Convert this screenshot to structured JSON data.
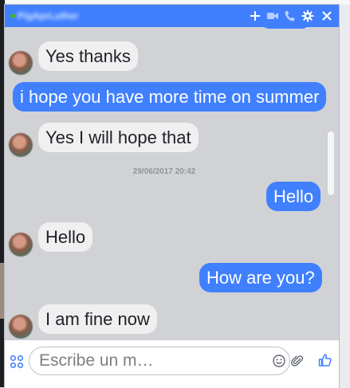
{
  "chat": {
    "contact_name": "PigAprLuther",
    "colors": {
      "accent": "#4080ff",
      "incoming": "#f1f0f0",
      "window_bg": "#d1d2d5"
    },
    "header_icons": [
      "plus-icon",
      "video-icon",
      "phone-icon",
      "gear-icon",
      "close-icon"
    ],
    "messages": [
      {
        "from": "them",
        "text": "Yes thanks"
      },
      {
        "from": "me",
        "text": "i hope you have more time on summer"
      },
      {
        "from": "them",
        "text": "Yes I will hope that"
      },
      {
        "from": "me",
        "text": "Hello"
      },
      {
        "from": "them",
        "text": "Hello"
      },
      {
        "from": "me",
        "text": "How are you?"
      },
      {
        "from": "them",
        "text": "I am fine now"
      }
    ],
    "timestamp": "29/06/2017 20:42"
  },
  "composer": {
    "placeholder": "Escribe un m…",
    "icons": [
      "apps-icon",
      "emoji-icon",
      "paperclip-icon",
      "like-icon"
    ]
  }
}
